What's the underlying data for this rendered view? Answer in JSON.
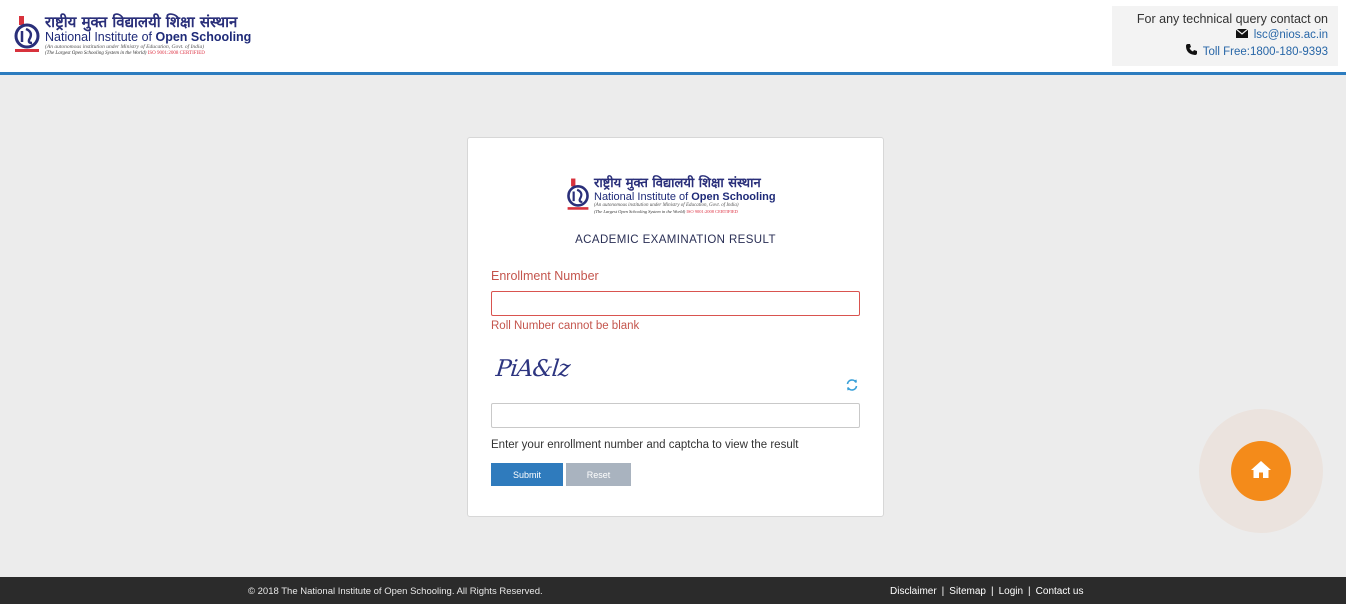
{
  "header": {
    "brand": {
      "hindi": "राष्ट्रीय मुक्त विद्यालयी शिक्षा संस्थान",
      "english_prefix": "National Institute of ",
      "english_bold": "Open Schooling",
      "sub1": "(An autonomous institution under Ministry of Education, Govt. of India)",
      "sub2": "(The Largest Open Schooling System in the World)",
      "sub2_iso": "ISO 9001:2008 CERTIFIED"
    },
    "contact": {
      "title": "For any technical query contact on",
      "email": "lsc@nios.ac.in",
      "phone": "Toll Free:1800-180-9393"
    }
  },
  "card": {
    "title": "ACADEMIC EXAMINATION RESULT",
    "enrollment_label": "Enrollment Number",
    "enrollment_value": "",
    "error": "Roll Number cannot be blank",
    "captcha_text": "PiA&lz",
    "captcha_value": "",
    "help": "Enter your enrollment number and captcha to view the result",
    "submit_label": "Submit",
    "reset_label": "Reset"
  },
  "footer": {
    "copyright": "© 2018 The National Institute of Open Schooling. All Rights Reserved.",
    "links": [
      "Disclaimer",
      "Sitemap",
      "Login",
      "Contact us"
    ]
  },
  "colors": {
    "header_border": "#2c7cbf",
    "error": "#c4554d",
    "submit": "#2f7bbd",
    "reset": "#a9b3bf",
    "home": "#f48b1a",
    "footer": "#2b2b2b"
  },
  "icons": {
    "email": "envelope-icon",
    "phone": "phone-icon",
    "refresh": "refresh-icon",
    "home": "home-icon"
  }
}
